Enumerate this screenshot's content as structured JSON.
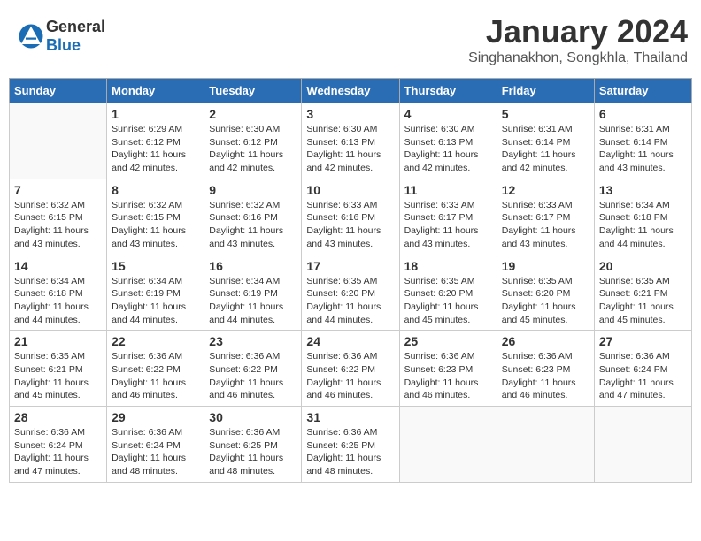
{
  "header": {
    "logo_general": "General",
    "logo_blue": "Blue",
    "title": "January 2024",
    "location": "Singhanakhon, Songkhla, Thailand"
  },
  "weekdays": [
    "Sunday",
    "Monday",
    "Tuesday",
    "Wednesday",
    "Thursday",
    "Friday",
    "Saturday"
  ],
  "weeks": [
    [
      {
        "day": "",
        "info": ""
      },
      {
        "day": "1",
        "info": "Sunrise: 6:29 AM\nSunset: 6:12 PM\nDaylight: 11 hours\nand 42 minutes."
      },
      {
        "day": "2",
        "info": "Sunrise: 6:30 AM\nSunset: 6:12 PM\nDaylight: 11 hours\nand 42 minutes."
      },
      {
        "day": "3",
        "info": "Sunrise: 6:30 AM\nSunset: 6:13 PM\nDaylight: 11 hours\nand 42 minutes."
      },
      {
        "day": "4",
        "info": "Sunrise: 6:30 AM\nSunset: 6:13 PM\nDaylight: 11 hours\nand 42 minutes."
      },
      {
        "day": "5",
        "info": "Sunrise: 6:31 AM\nSunset: 6:14 PM\nDaylight: 11 hours\nand 42 minutes."
      },
      {
        "day": "6",
        "info": "Sunrise: 6:31 AM\nSunset: 6:14 PM\nDaylight: 11 hours\nand 43 minutes."
      }
    ],
    [
      {
        "day": "7",
        "info": "Sunrise: 6:32 AM\nSunset: 6:15 PM\nDaylight: 11 hours\nand 43 minutes."
      },
      {
        "day": "8",
        "info": "Sunrise: 6:32 AM\nSunset: 6:15 PM\nDaylight: 11 hours\nand 43 minutes."
      },
      {
        "day": "9",
        "info": "Sunrise: 6:32 AM\nSunset: 6:16 PM\nDaylight: 11 hours\nand 43 minutes."
      },
      {
        "day": "10",
        "info": "Sunrise: 6:33 AM\nSunset: 6:16 PM\nDaylight: 11 hours\nand 43 minutes."
      },
      {
        "day": "11",
        "info": "Sunrise: 6:33 AM\nSunset: 6:17 PM\nDaylight: 11 hours\nand 43 minutes."
      },
      {
        "day": "12",
        "info": "Sunrise: 6:33 AM\nSunset: 6:17 PM\nDaylight: 11 hours\nand 43 minutes."
      },
      {
        "day": "13",
        "info": "Sunrise: 6:34 AM\nSunset: 6:18 PM\nDaylight: 11 hours\nand 44 minutes."
      }
    ],
    [
      {
        "day": "14",
        "info": "Sunrise: 6:34 AM\nSunset: 6:18 PM\nDaylight: 11 hours\nand 44 minutes."
      },
      {
        "day": "15",
        "info": "Sunrise: 6:34 AM\nSunset: 6:19 PM\nDaylight: 11 hours\nand 44 minutes."
      },
      {
        "day": "16",
        "info": "Sunrise: 6:34 AM\nSunset: 6:19 PM\nDaylight: 11 hours\nand 44 minutes."
      },
      {
        "day": "17",
        "info": "Sunrise: 6:35 AM\nSunset: 6:20 PM\nDaylight: 11 hours\nand 44 minutes."
      },
      {
        "day": "18",
        "info": "Sunrise: 6:35 AM\nSunset: 6:20 PM\nDaylight: 11 hours\nand 45 minutes."
      },
      {
        "day": "19",
        "info": "Sunrise: 6:35 AM\nSunset: 6:20 PM\nDaylight: 11 hours\nand 45 minutes."
      },
      {
        "day": "20",
        "info": "Sunrise: 6:35 AM\nSunset: 6:21 PM\nDaylight: 11 hours\nand 45 minutes."
      }
    ],
    [
      {
        "day": "21",
        "info": "Sunrise: 6:35 AM\nSunset: 6:21 PM\nDaylight: 11 hours\nand 45 minutes."
      },
      {
        "day": "22",
        "info": "Sunrise: 6:36 AM\nSunset: 6:22 PM\nDaylight: 11 hours\nand 46 minutes."
      },
      {
        "day": "23",
        "info": "Sunrise: 6:36 AM\nSunset: 6:22 PM\nDaylight: 11 hours\nand 46 minutes."
      },
      {
        "day": "24",
        "info": "Sunrise: 6:36 AM\nSunset: 6:22 PM\nDaylight: 11 hours\nand 46 minutes."
      },
      {
        "day": "25",
        "info": "Sunrise: 6:36 AM\nSunset: 6:23 PM\nDaylight: 11 hours\nand 46 minutes."
      },
      {
        "day": "26",
        "info": "Sunrise: 6:36 AM\nSunset: 6:23 PM\nDaylight: 11 hours\nand 46 minutes."
      },
      {
        "day": "27",
        "info": "Sunrise: 6:36 AM\nSunset: 6:24 PM\nDaylight: 11 hours\nand 47 minutes."
      }
    ],
    [
      {
        "day": "28",
        "info": "Sunrise: 6:36 AM\nSunset: 6:24 PM\nDaylight: 11 hours\nand 47 minutes."
      },
      {
        "day": "29",
        "info": "Sunrise: 6:36 AM\nSunset: 6:24 PM\nDaylight: 11 hours\nand 48 minutes."
      },
      {
        "day": "30",
        "info": "Sunrise: 6:36 AM\nSunset: 6:25 PM\nDaylight: 11 hours\nand 48 minutes."
      },
      {
        "day": "31",
        "info": "Sunrise: 6:36 AM\nSunset: 6:25 PM\nDaylight: 11 hours\nand 48 minutes."
      },
      {
        "day": "",
        "info": ""
      },
      {
        "day": "",
        "info": ""
      },
      {
        "day": "",
        "info": ""
      }
    ]
  ]
}
